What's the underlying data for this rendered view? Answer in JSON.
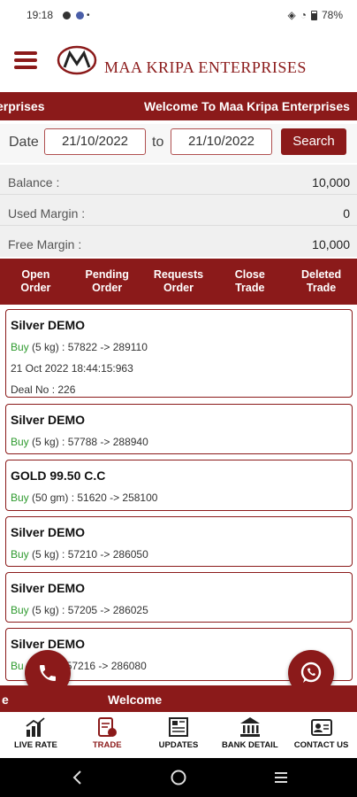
{
  "status_bar": {
    "time": "19:18",
    "battery": "78%"
  },
  "header": {
    "brand": "MAA KRIPA ENTERPRISES"
  },
  "top_marquee": {
    "left": "erprises",
    "right": "Welcome To Maa Kripa Enterprises"
  },
  "filter": {
    "date_label": "Date",
    "from_date": "21/10/2022",
    "to_label": "to",
    "to_date": "21/10/2022",
    "search_label": "Search"
  },
  "summary": [
    {
      "label": "Balance :",
      "value": "10,000"
    },
    {
      "label": "Used Margin :",
      "value": "0"
    },
    {
      "label": "Free Margin :",
      "value": "10,000"
    }
  ],
  "tabs": [
    "Open\nOrder",
    "Pending\nOrder",
    "Requests\nOrder",
    "Close\nTrade",
    "Deleted\nTrade"
  ],
  "orders": [
    {
      "title": "Silver DEMO",
      "side": "Buy",
      "detail": " (5 kg) : 57822 -> 289110",
      "timestamp": "21 Oct 2022 18:44:15:963",
      "deal": "Deal No : 226"
    },
    {
      "title": "Silver DEMO",
      "side": "Buy",
      "detail": " (5 kg) : 57788 -> 288940"
    },
    {
      "title": "GOLD 99.50 C.C",
      "side": "Buy",
      "detail": " (50 gm) : 51620 -> 258100"
    },
    {
      "title": "Silver DEMO",
      "side": "Buy",
      "detail": " (5 kg) : 57210 -> 286050"
    },
    {
      "title": "Silver DEMO",
      "side": "Buy",
      "detail": " (5 kg) : 57205 -> 286025"
    },
    {
      "title": "Silver DEMO",
      "side": "Bu",
      "detail": "57216 -> 286080"
    }
  ],
  "bottom_marquee": {
    "left": "e",
    "right": "Welcome"
  },
  "nav": [
    {
      "label": "LIVE RATE",
      "icon": "chart-icon"
    },
    {
      "label": "TRADE",
      "icon": "trade-icon",
      "active": true
    },
    {
      "label": "UPDATES",
      "icon": "newspaper-icon"
    },
    {
      "label": "BANK DETAIL",
      "icon": "bank-icon"
    },
    {
      "label": "CONTACT US",
      "icon": "contact-card-icon"
    }
  ],
  "colors": {
    "accent": "#8b1a1a",
    "buy": "#2e9a2e"
  }
}
